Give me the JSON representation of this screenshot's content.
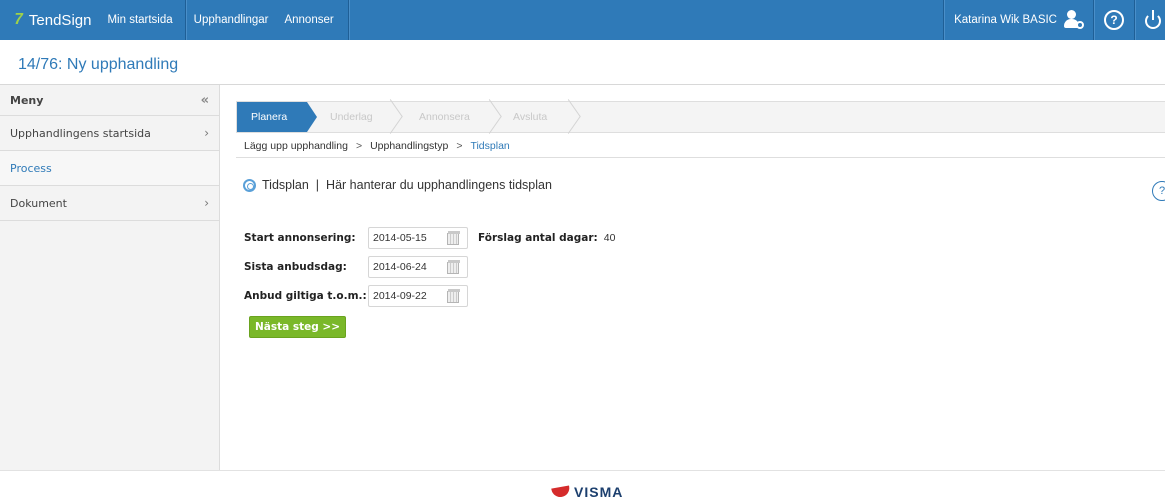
{
  "brand": {
    "name": "TendSign",
    "mark": "7"
  },
  "nav": {
    "items": [
      "Min startsida",
      "Upphandlingar",
      "Annonser"
    ]
  },
  "user": {
    "name": "Katarina Wik BASIC",
    "help_symbol": "?"
  },
  "page": {
    "title": "14/76: Ny upphandling"
  },
  "sidebar": {
    "heading": "Meny",
    "collapse_symbol": "«",
    "items": [
      {
        "label": "Upphandlingens startsida",
        "chevron": "›"
      },
      {
        "label": "Process",
        "chevron": ""
      },
      {
        "label": "Dokument",
        "chevron": "›"
      }
    ]
  },
  "steps": {
    "items": [
      "Planera",
      "Underlag",
      "Annonsera",
      "Avsluta"
    ]
  },
  "breadcrumb": {
    "items": [
      "Lägg upp upphandling",
      "Upphandlingstyp",
      "Tidsplan"
    ],
    "separator": ">"
  },
  "section": {
    "title": "Tidsplan",
    "divider": "|",
    "description": "Här hanterar du upphandlingens tidsplan",
    "help_symbol": "?"
  },
  "form": {
    "start": {
      "label": "Start annonsering:",
      "value": "2014-05-15"
    },
    "suggest": {
      "label": "Förslag antal dagar:",
      "value": "40"
    },
    "deadline": {
      "label": "Sista anbudsdag:",
      "value": "2014-06-24"
    },
    "valid": {
      "label": "Anbud giltiga t.o.m.:",
      "value": "2014-09-22"
    },
    "next_button": "Nästa steg >>"
  },
  "footer": {
    "logo_text": "VISMA"
  },
  "colors": {
    "primary": "#2f7ab8",
    "accent_green": "#7ab829",
    "footer_logo": "#1c3f6e"
  }
}
